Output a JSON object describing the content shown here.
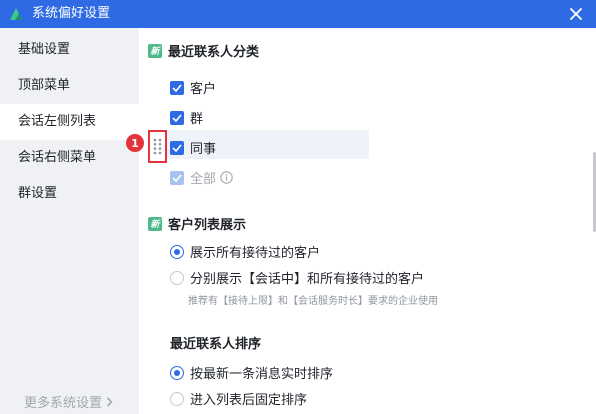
{
  "window": {
    "title": "系统偏好设置",
    "accent": "#2d6ae3"
  },
  "sidebar": {
    "items": [
      {
        "label": "基础设置",
        "active": false
      },
      {
        "label": "顶部菜单",
        "active": false
      },
      {
        "label": "会话左侧列表",
        "active": true
      },
      {
        "label": "会话右侧菜单",
        "active": false
      },
      {
        "label": "群设置",
        "active": false
      }
    ],
    "more_label": "更多系统设置"
  },
  "section1": {
    "badge": "新",
    "title": "最近联系人分类",
    "options": [
      {
        "label": "客户",
        "checked": true
      },
      {
        "label": "群",
        "checked": true
      },
      {
        "label": "同事",
        "checked": true
      },
      {
        "label": "全部",
        "checked": true,
        "disabled": true
      }
    ],
    "annotation_number": "1"
  },
  "section2": {
    "badge": "新",
    "title": "客户列表展示",
    "options": [
      {
        "label": "展示所有接待过的客户",
        "selected": true
      },
      {
        "label": "分别展示【会话中】和所有接待过的客户",
        "selected": false
      }
    ],
    "hint": "推荐有【接待上限】和【会话服务时长】要求的企业使用"
  },
  "section3": {
    "title": "最近联系人排序",
    "options": [
      {
        "label": "按最新一条消息实时排序",
        "selected": true
      },
      {
        "label": "进入列表后固定排序",
        "selected": false
      }
    ]
  }
}
